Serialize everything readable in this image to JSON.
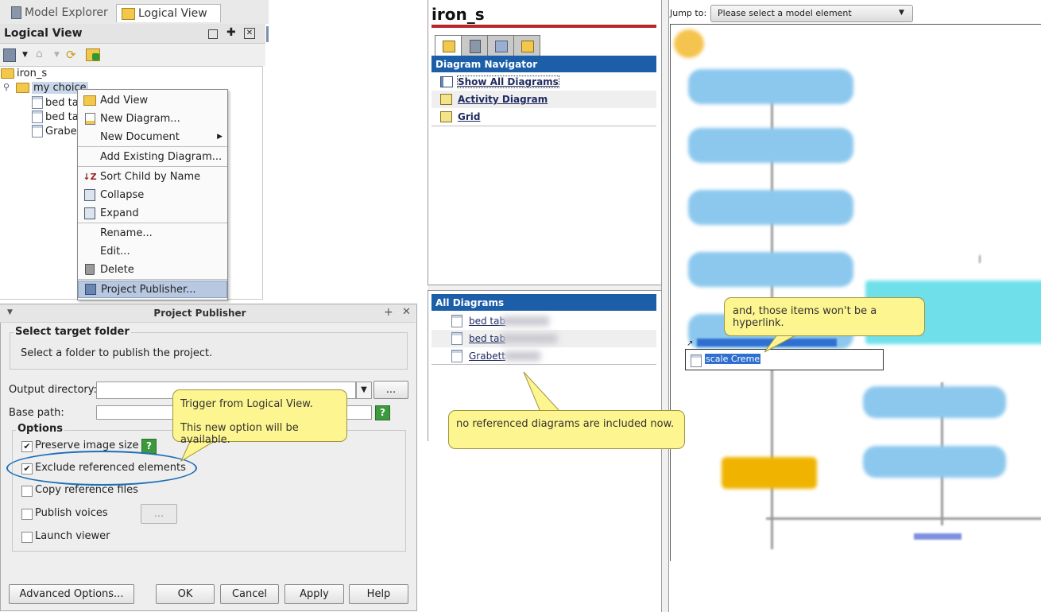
{
  "tabs": {
    "model_explorer": "Model Explorer",
    "logical_view": "Logical View"
  },
  "logical_view": {
    "title": "Logical View",
    "tree": {
      "root": "iron_s",
      "folder": "my choice",
      "items": [
        "bed ta",
        "bed ta",
        "Grabe"
      ]
    }
  },
  "context_menu": {
    "items": [
      {
        "label": "Add View",
        "icon": "folder-add-icon"
      },
      {
        "label": "New Diagram...",
        "icon": "new-diagram-icon"
      },
      {
        "label": "New Document",
        "icon": ""
      },
      {
        "label": "Add Existing Diagram...",
        "icon": ""
      },
      {
        "label": "Sort Child by Name",
        "icon": "sort-az-icon"
      },
      {
        "label": "Collapse",
        "icon": "collapse-icon"
      },
      {
        "label": "Expand",
        "icon": "expand-icon"
      },
      {
        "label": "Rename...",
        "icon": ""
      },
      {
        "label": "Edit...",
        "icon": ""
      },
      {
        "label": "Delete",
        "icon": "trash-icon"
      },
      {
        "label": "Project Publisher...",
        "icon": "publisher-icon"
      }
    ]
  },
  "dialog": {
    "title": "Project Publisher",
    "section_title": "Select target folder",
    "section_desc": "Select a folder to publish the project.",
    "output_directory_label": "Output directory:",
    "output_directory_value": "",
    "browse_label": "...",
    "base_path_label": "Base path:",
    "options_label": "Options",
    "options": [
      {
        "label": "Preserve image size",
        "checked": true
      },
      {
        "label": "Exclude referenced elements",
        "checked": true
      },
      {
        "label": "Copy reference files",
        "checked": false
      },
      {
        "label": "Publish voices",
        "checked": false
      },
      {
        "label": "Launch viewer",
        "checked": false
      }
    ],
    "voices_browse_label": "...",
    "buttons": {
      "advanced": "Advanced Options...",
      "ok": "OK",
      "cancel": "Cancel",
      "apply": "Apply",
      "help": "Help"
    }
  },
  "callouts": {
    "trigger_line1": "Trigger from Logical View.",
    "trigger_line2": "This new option will be available.",
    "no_referenced": "no referenced diagrams are included now.",
    "hyperlink": "and, those items won't be a hyperlink."
  },
  "preview": {
    "project_title": "iron_s",
    "diagram_navigator_title": "Diagram Navigator",
    "navigator_items": [
      "Show All Diagrams",
      "Activity Diagram",
      "Grid"
    ],
    "all_diagrams_title": "All Diagrams",
    "all_diagrams_items": [
      "bed tab",
      "bed tab",
      "Grabett"
    ],
    "jump_to_label": "Jump to:",
    "jump_to_placeholder": "Please select a model element",
    "popup_item": "scale Creme"
  },
  "colors": {
    "accent_blue": "#1c5ea8",
    "callout_yellow": "#fdf58f",
    "ellipse_blue": "#1d6fb8"
  }
}
